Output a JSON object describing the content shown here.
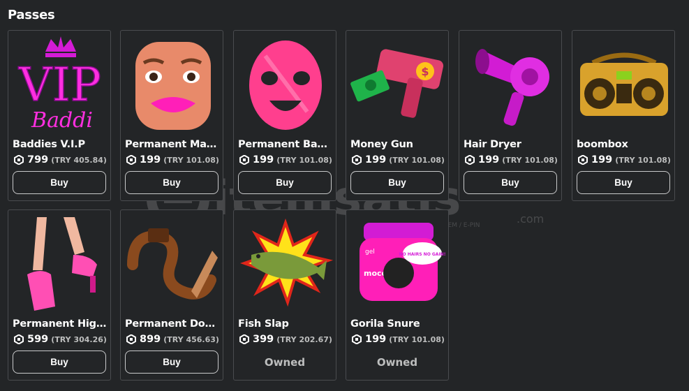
{
  "section_title": "Passes",
  "currency_icon": "robux-icon",
  "watermark": {
    "brand": "itemsatis",
    "tagline": "HESAP / SKIN / ITEM / E-PIN",
    "suffix": ".com"
  },
  "passes": [
    {
      "name": "Baddies V.I.P",
      "price": "799",
      "local_price": "(TRY 405.84)",
      "action": "Buy",
      "owned": false,
      "thumb_text_main": "VIP",
      "thumb_text_sub": "Baddi"
    },
    {
      "name": "Permanent Make...",
      "price": "199",
      "local_price": "(TRY 101.08)",
      "action": "Buy",
      "owned": false
    },
    {
      "name": "Permanent Badd...",
      "price": "199",
      "local_price": "(TRY 101.08)",
      "action": "Buy",
      "owned": false
    },
    {
      "name": "Money Gun",
      "price": "199",
      "local_price": "(TRY 101.08)",
      "action": "Buy",
      "owned": false
    },
    {
      "name": "Hair Dryer",
      "price": "199",
      "local_price": "(TRY 101.08)",
      "action": "Buy",
      "owned": false
    },
    {
      "name": "boombox",
      "price": "199",
      "local_price": "(TRY 101.08)",
      "action": "Buy",
      "owned": false
    },
    {
      "name": "Permanent High ...",
      "price": "599",
      "local_price": "(TRY 304.26)",
      "action": "Buy",
      "owned": false
    },
    {
      "name": "Permanent Dog ...",
      "price": "899",
      "local_price": "(TRY 456.63)",
      "action": "Buy",
      "owned": false
    },
    {
      "name": "Fish Slap",
      "price": "399",
      "local_price": "(TRY 202.67)",
      "action": "Owned",
      "owned": true
    },
    {
      "name": "Gorila Snure",
      "price": "199",
      "local_price": "(TRY 101.08)",
      "action": "Owned",
      "owned": true,
      "thumb_text_main": "gel",
      "thumb_text_sub": "moco gori",
      "thumb_text_bubble": "NO HAIRS NO GAIN!"
    }
  ]
}
